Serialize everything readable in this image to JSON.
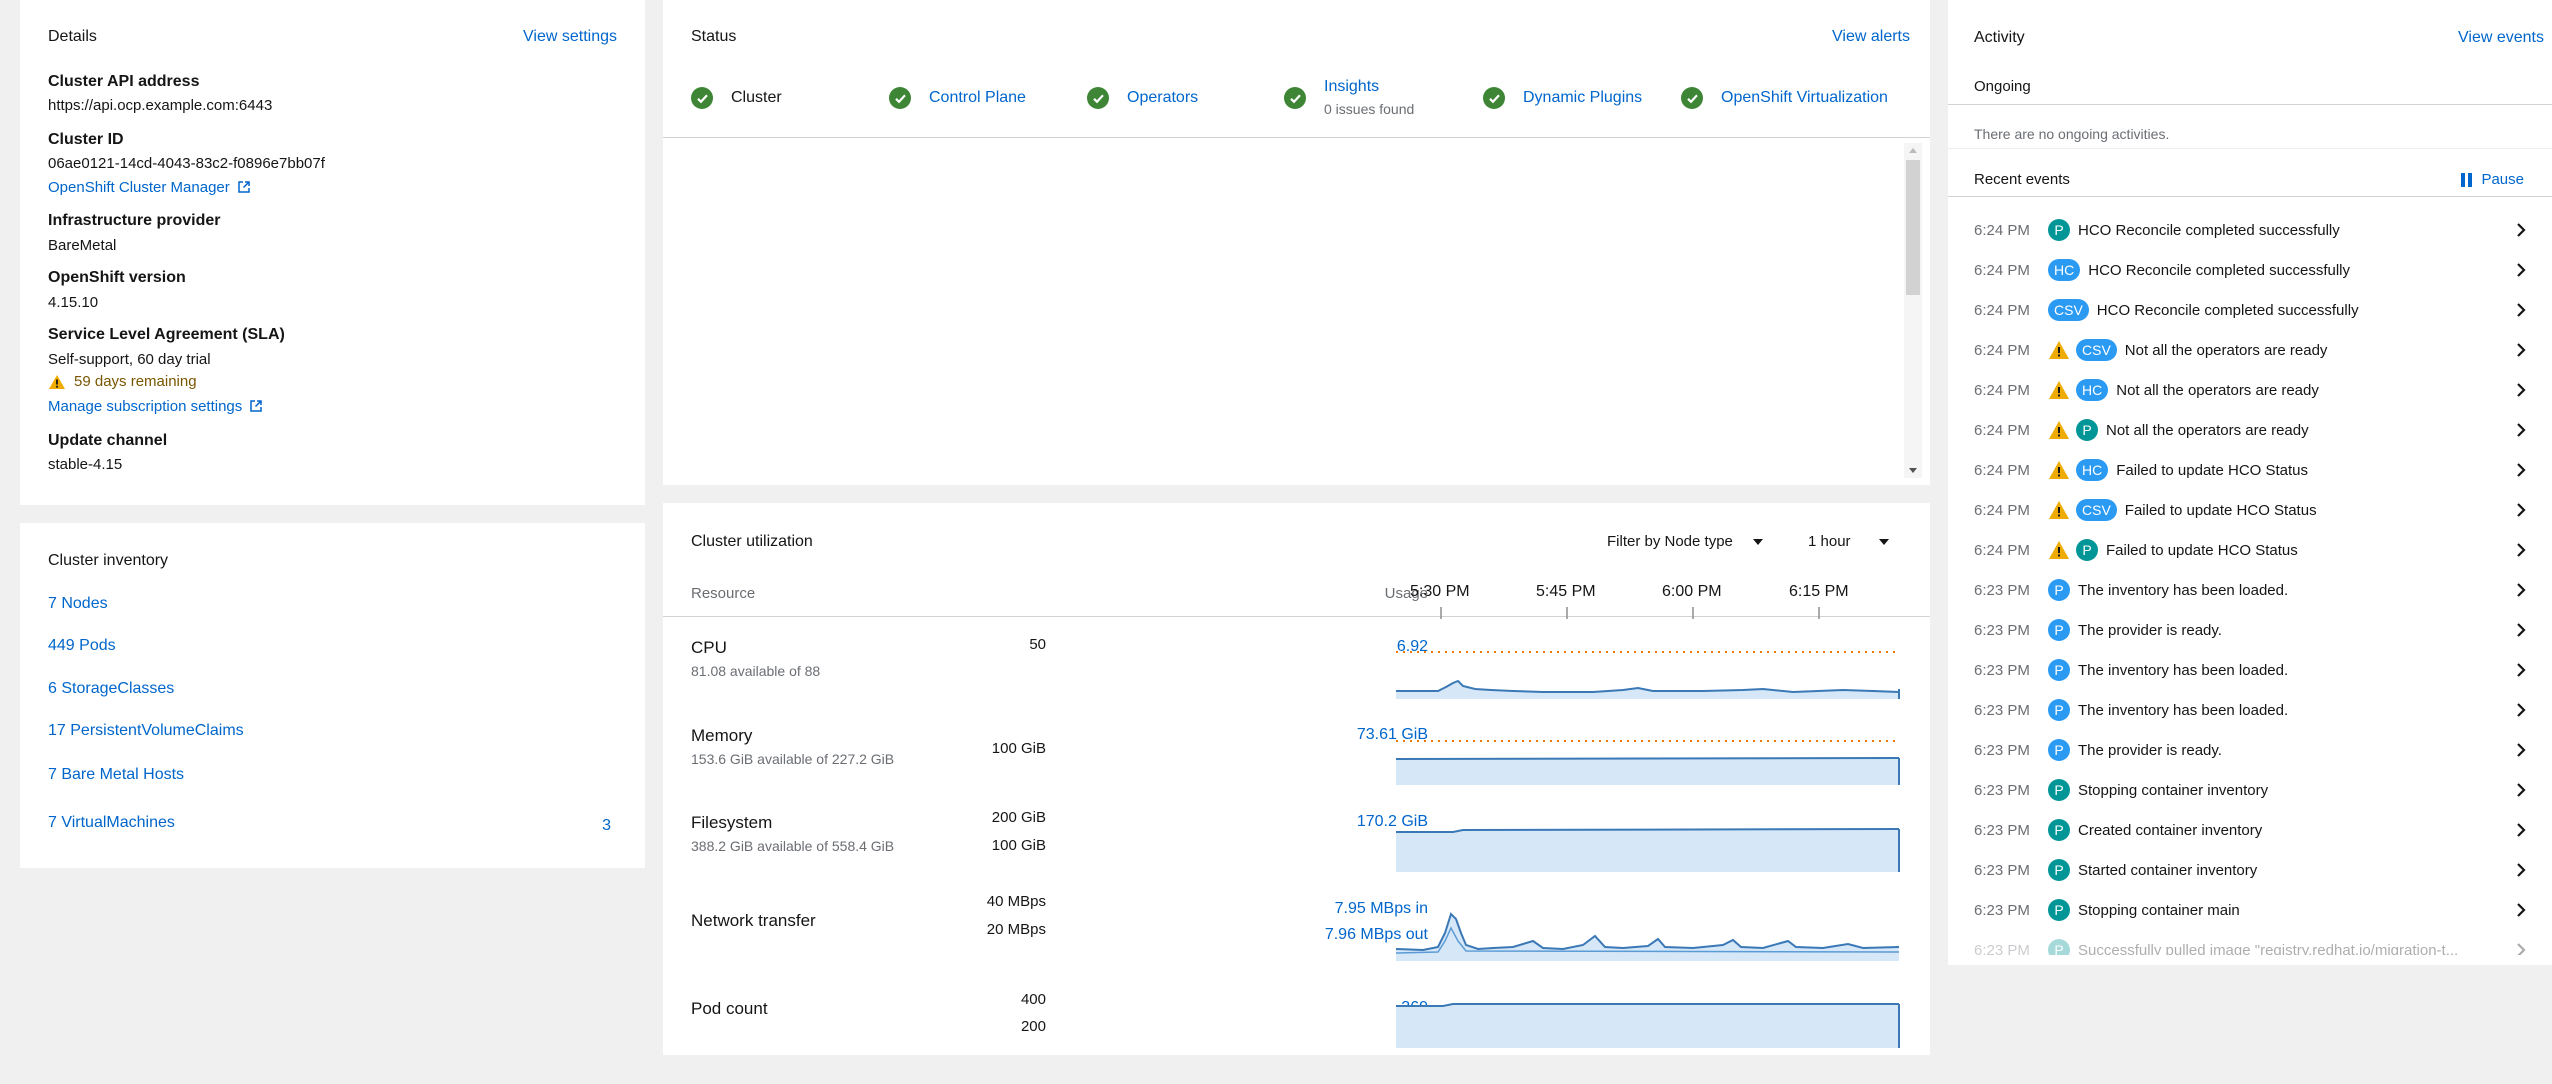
{
  "details": {
    "title": "Details",
    "view_settings": "View settings",
    "api_label": "Cluster API address",
    "api_value": "https://api.ocp.example.com:6443",
    "id_label": "Cluster ID",
    "id_value": "06ae0121-14cd-4043-83c2-f0896e7bb07f",
    "ocm_link": "OpenShift Cluster Manager",
    "infra_label": "Infrastructure provider",
    "infra_value": "BareMetal",
    "version_label": "OpenShift version",
    "version_value": "4.15.10",
    "sla_label": "Service Level Agreement (SLA)",
    "sla_value": "Self-support, 60 day trial",
    "sla_warning": "59 days remaining",
    "manage_link": "Manage subscription settings",
    "channel_label": "Update channel",
    "channel_value": "stable-4.15"
  },
  "inventory": {
    "title": "Cluster inventory",
    "items": [
      {
        "label": "7 Nodes"
      },
      {
        "label": "449 Pods"
      },
      {
        "label": "6 StorageClasses"
      },
      {
        "label": "17 PersistentVolumeClaims"
      },
      {
        "label": "7 Bare Metal Hosts"
      },
      {
        "label": "7 VirtualMachines",
        "count": "3"
      }
    ]
  },
  "status": {
    "title": "Status",
    "view_alerts": "View alerts",
    "items": [
      {
        "label": "Cluster",
        "link": false
      },
      {
        "label": "Control Plane",
        "link": true
      },
      {
        "label": "Operators",
        "link": true
      },
      {
        "label": "Insights",
        "sub": "0 issues found",
        "link": true
      },
      {
        "label": "Dynamic Plugins",
        "link": true
      },
      {
        "label": "OpenShift Virtualization",
        "link": true
      }
    ]
  },
  "utilization": {
    "title": "Cluster utilization",
    "filter": "Filter by Node type",
    "range": "1 hour",
    "col_resource": "Resource",
    "col_usage": "Usage",
    "time_ticks": [
      "5:30 PM",
      "5:45 PM",
      "6:00 PM",
      "6:15 PM"
    ],
    "rows": [
      {
        "name": "CPU",
        "sub": "81.08 available of 88",
        "value": "6.92",
        "axis": [
          "50"
        ]
      },
      {
        "name": "Memory",
        "sub": "153.6 GiB available of 227.2 GiB",
        "value": "73.61 GiB",
        "axis": [
          "100 GiB"
        ]
      },
      {
        "name": "Filesystem",
        "sub": "388.2 GiB available of 558.4 GiB",
        "value": "170.2 GiB",
        "axis": [
          "200 GiB",
          "100 GiB"
        ]
      },
      {
        "name": "Network transfer",
        "sub": "",
        "value": "7.95 MBps in",
        "value2": "7.96 MBps out",
        "axis": [
          "40 MBps",
          "20 MBps"
        ]
      },
      {
        "name": "Pod count",
        "sub": "",
        "value": "369",
        "axis": [
          "400",
          "200"
        ]
      }
    ]
  },
  "activity": {
    "title": "Activity",
    "view_events": "View events",
    "ongoing_label": "Ongoing",
    "ongoing_empty": "There are no ongoing activities.",
    "recent_label": "Recent events",
    "pause": "Pause",
    "events": [
      {
        "time": "6:24 PM",
        "warn": false,
        "badge": "P",
        "kind": "teal",
        "text": "HCO Reconcile completed successfully"
      },
      {
        "time": "6:24 PM",
        "warn": false,
        "badge": "HC",
        "kind": "blue",
        "text": "HCO Reconcile completed successfully"
      },
      {
        "time": "6:24 PM",
        "warn": false,
        "badge": "CSV",
        "kind": "blue",
        "text": "HCO Reconcile completed successfully"
      },
      {
        "time": "6:24 PM",
        "warn": true,
        "badge": "CSV",
        "kind": "blue",
        "text": "Not all the operators are ready"
      },
      {
        "time": "6:24 PM",
        "warn": true,
        "badge": "HC",
        "kind": "blue",
        "text": "Not all the operators are ready"
      },
      {
        "time": "6:24 PM",
        "warn": true,
        "badge": "P",
        "kind": "teal",
        "text": "Not all the operators are ready"
      },
      {
        "time": "6:24 PM",
        "warn": true,
        "badge": "HC",
        "kind": "blue",
        "text": "Failed to update HCO Status"
      },
      {
        "time": "6:24 PM",
        "warn": true,
        "badge": "CSV",
        "kind": "blue",
        "text": "Failed to update HCO Status"
      },
      {
        "time": "6:24 PM",
        "warn": true,
        "badge": "P",
        "kind": "teal",
        "text": "Failed to update HCO Status"
      },
      {
        "time": "6:23 PM",
        "warn": false,
        "badge": "P",
        "kind": "p-blue",
        "text": "The inventory has been loaded."
      },
      {
        "time": "6:23 PM",
        "warn": false,
        "badge": "P",
        "kind": "p-blue",
        "text": "The provider is ready."
      },
      {
        "time": "6:23 PM",
        "warn": false,
        "badge": "P",
        "kind": "p-blue",
        "text": "The inventory has been loaded."
      },
      {
        "time": "6:23 PM",
        "warn": false,
        "badge": "P",
        "kind": "p-blue",
        "text": "The inventory has been loaded."
      },
      {
        "time": "6:23 PM",
        "warn": false,
        "badge": "P",
        "kind": "p-blue",
        "text": "The provider is ready."
      },
      {
        "time": "6:23 PM",
        "warn": false,
        "badge": "P",
        "kind": "teal",
        "text": "Stopping container inventory"
      },
      {
        "time": "6:23 PM",
        "warn": false,
        "badge": "P",
        "kind": "teal",
        "text": "Created container inventory"
      },
      {
        "time": "6:23 PM",
        "warn": false,
        "badge": "P",
        "kind": "teal",
        "text": "Started container inventory"
      },
      {
        "time": "6:23 PM",
        "warn": false,
        "badge": "P",
        "kind": "teal",
        "text": "Stopping container main"
      },
      {
        "time": "6:23 PM",
        "warn": false,
        "badge": "P",
        "kind": "teal",
        "text": "Successfully pulled image \"registry.redhat.io/migration-t..."
      }
    ]
  },
  "colors": {
    "link": "#0066cc",
    "success": "#3e8635",
    "warning": "#f0ab00",
    "chart_line": "#3a78b6",
    "chart_fill": "#d6e7f8",
    "limit_line": "#ec7a08"
  }
}
